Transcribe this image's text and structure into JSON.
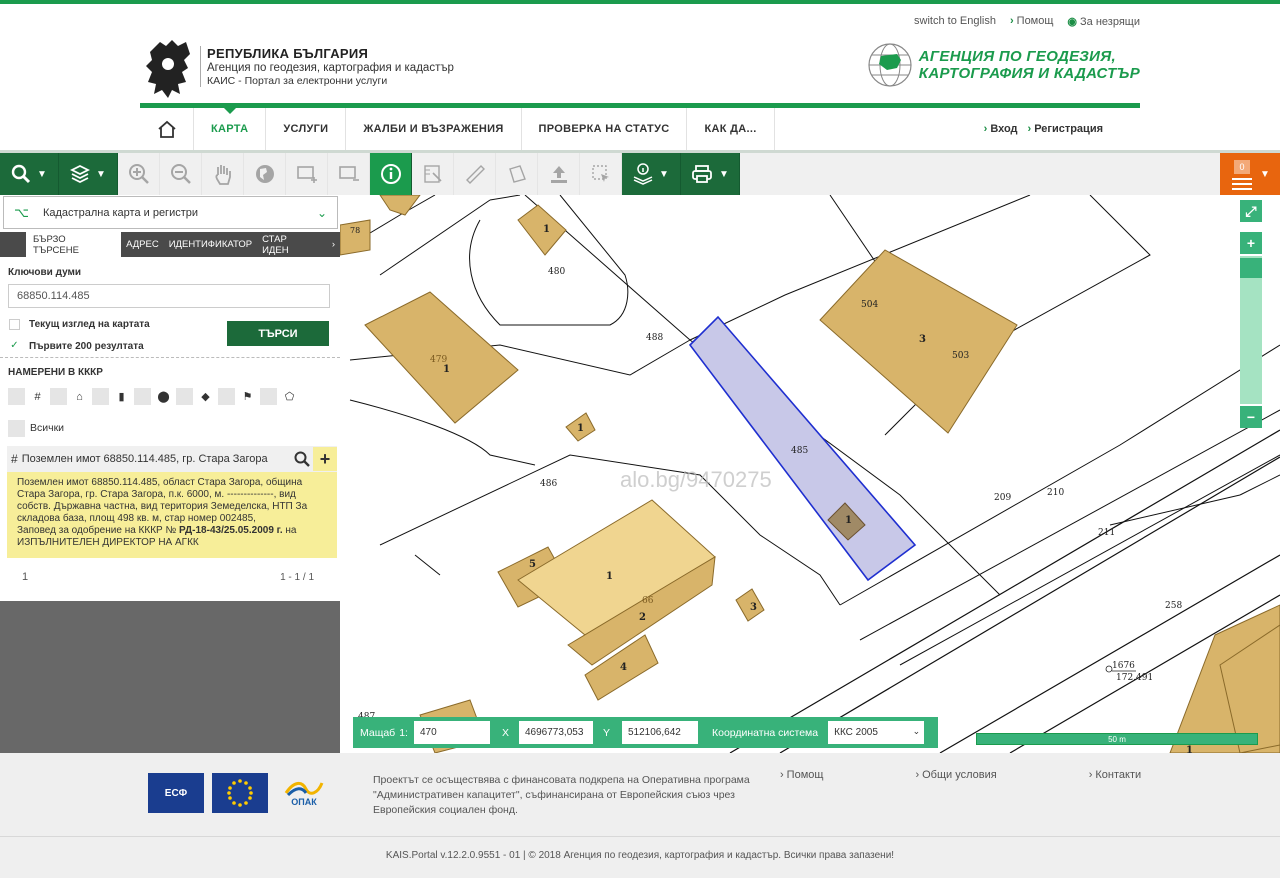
{
  "util": {
    "lang": "switch to English",
    "help": "Помощ",
    "a11y": "За незрящи"
  },
  "brand": {
    "line1": "РЕПУБЛИКА БЪЛГАРИЯ",
    "line2": "Агенция по геодезия, картография и кадастър",
    "line3": "КАИС - Портал за електронни услуги",
    "agency_line1": "АГЕНЦИЯ ПО ГЕОДЕЗИЯ,",
    "agency_line2": "КАРТОГРАФИЯ И КАДАСТЪР"
  },
  "nav": {
    "items": [
      "КАРТА",
      "УСЛУГИ",
      "ЖАЛБИ И ВЪЗРАЖЕНИЯ",
      "ПРОВЕРКА НА СТАТУС",
      "КАК ДА..."
    ],
    "login": "Вход",
    "register": "Регистрация"
  },
  "toolbar": {
    "cart_count": "0"
  },
  "panel": {
    "layer": "Кадастрална карта и регистри",
    "tabs": [
      "БЪРЗО ТЪРСЕНЕ",
      "АДРЕС",
      "ИДЕНТИФИКАТОР",
      "СТАР ИДЕН"
    ],
    "keywords_label": "Ключови думи",
    "keywords_value": "68850.114.485",
    "current_view": "Текущ изглед на картата",
    "first200": "Първите 200 резултата",
    "search_btn": "ТЪРСИ",
    "found_label": "НАМЕРЕНИ В КККР",
    "all_label": "Всички",
    "result_title": "Поземлен имот 68850.114.485, гр. Стара Загора",
    "result_body1": "Поземлен имот 68850.114.485, област Стара Загора, община Стара Загора, гр. Стара Загора, п.к. 6000, м. --------------, вид собств. Държавна частна, вид територия Земеделска, НТП За складова база, площ 498 кв. м, стар номер 002485,",
    "result_body2": "Заповед за одобрение на КККР № ",
    "result_body_bold": "РД-18-43/25.05.2009 г.",
    "result_body3": " на ИЗПЪЛНИТЕЛЕН ДИРЕКТОР НА АГКК",
    "page": "1",
    "range": "1 - 1 / 1"
  },
  "map": {
    "watermark": "alo.bg/9470275",
    "labels": [
      "480",
      "488",
      "504",
      "503",
      "479",
      "485",
      "486",
      "209",
      "210",
      "211",
      "258",
      "487",
      "66",
      "1676",
      "172.491"
    ],
    "building_nums": [
      "1",
      "1",
      "1",
      "3",
      "1",
      "1",
      "5",
      "2",
      "4",
      "3",
      "1",
      "78"
    ]
  },
  "coords": {
    "scale_label": "Мащаб",
    "scale_prefix": "1:",
    "scale": "470",
    "x_label": "X",
    "x": "4696773,053",
    "y_label": "Y",
    "y": "512106,642",
    "cs_label": "Координатна система",
    "cs": "ККС 2005",
    "scalebar": "50 m"
  },
  "footer": {
    "logo1": "ЕСФ",
    "logo3": "ОПАК",
    "project": "Проектът се осъществява с финансовата подкрепа на Оперативна програма \"Административен капацитет\", съфинансирана от Европейския съюз чрез Европейския социален фонд.",
    "help": "Помощ",
    "terms": "Общи условия",
    "contacts": "Контакти",
    "copyright": "KAIS.Portal v.12.2.0.9551 - 01  |  © 2018 Агенция по геодезия, картография и кадастър. Всички права запазени!"
  },
  "colors": {
    "brand_green": "#1b9b4d",
    "dark_green": "#1c6a3a",
    "cart_orange": "#e8650e",
    "parcel_fill": "#d8b46a",
    "highlight": "#c8c8e8"
  }
}
